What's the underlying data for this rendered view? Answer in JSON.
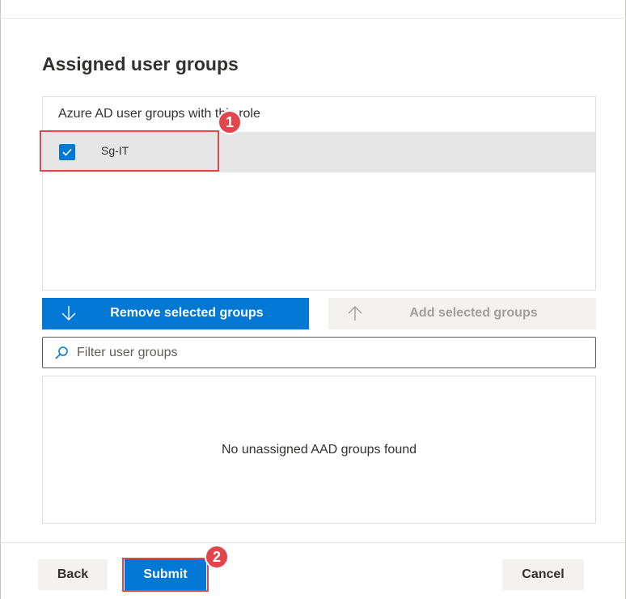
{
  "section": {
    "title": "Assigned user groups"
  },
  "assigned": {
    "header": "Azure AD user groups with this role",
    "groups": [
      {
        "name": "Sg-IT",
        "checked": true
      }
    ]
  },
  "actions": {
    "remove_label": "Remove selected groups",
    "add_label": "Add selected groups"
  },
  "filter": {
    "placeholder": "Filter user groups",
    "value": ""
  },
  "unassigned": {
    "empty_message": "No unassigned AAD groups found"
  },
  "footer": {
    "back_label": "Back",
    "submit_label": "Submit",
    "cancel_label": "Cancel"
  },
  "annotations": [
    {
      "number": "1"
    },
    {
      "number": "2"
    }
  ],
  "colors": {
    "accent": "#0078d4",
    "annotation": "#e0474c",
    "selected_row": "#e6e6e6",
    "neutral_button": "#f3f2f1"
  }
}
